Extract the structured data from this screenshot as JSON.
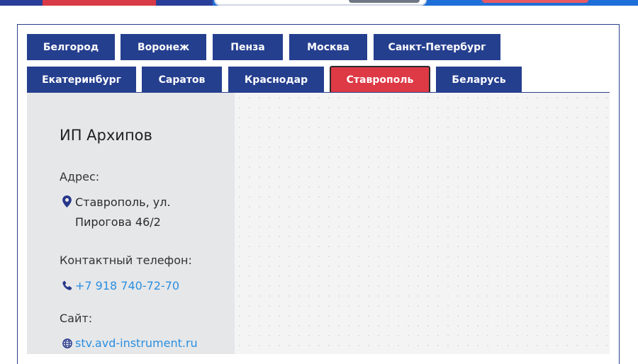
{
  "tabs": [
    {
      "label": "Белгород",
      "active": false
    },
    {
      "label": "Воронеж",
      "active": false
    },
    {
      "label": "Пенза",
      "active": false
    },
    {
      "label": "Москва",
      "active": false
    },
    {
      "label": "Санкт-Петербург",
      "active": false
    },
    {
      "label": "Екатеринбург",
      "active": false
    },
    {
      "label": "Саратов",
      "active": false
    },
    {
      "label": "Краснодар",
      "active": false
    },
    {
      "label": "Ставрополь",
      "active": true
    },
    {
      "label": "Беларусь",
      "active": false
    }
  ],
  "dealer": {
    "name": "ИП Архипов",
    "address_label": "Адрес:",
    "address_line1": "Ставрополь, ул.",
    "address_line2": "Пирогова 46/2",
    "phone_label": "Контактный телефон:",
    "phone": "+7 918 740-72-70",
    "site_label": "Сайт:",
    "site": "stv.avd-instrument.ru"
  },
  "icons": {
    "address": "map-pin-icon",
    "phone": "phone-icon",
    "site": "globe-icon"
  },
  "colors": {
    "tab": "#253f8f",
    "tab_active": "#de3a46",
    "link": "#2a8fe0",
    "panel": "#e6e7e9",
    "map": "#f4f4f4"
  }
}
